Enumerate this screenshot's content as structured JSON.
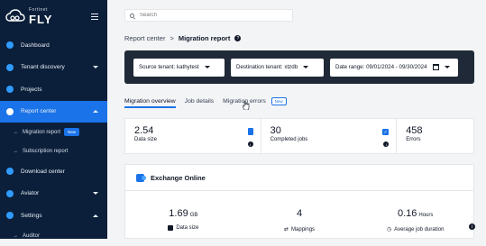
{
  "brand": {
    "top": "Fortinet",
    "name": "FLY"
  },
  "sidebar": {
    "items": [
      {
        "label": "Dashboard"
      },
      {
        "label": "Tenant discovery"
      },
      {
        "label": "Projects"
      },
      {
        "label": "Report center"
      },
      {
        "label": "Migration report",
        "badge": "New"
      },
      {
        "label": "Subscription report"
      },
      {
        "label": "Download center"
      },
      {
        "label": "Aviator"
      },
      {
        "label": "Settings"
      },
      {
        "label": "Auditor"
      }
    ]
  },
  "search": {
    "placeholder": "Search"
  },
  "breadcrumb": {
    "parent": "Report center",
    "separator": ">",
    "current": "Migration report"
  },
  "filters": {
    "source_label": "Source tenant:",
    "source_value": "kathytest",
    "destination_label": "Destination tenant:",
    "destination_value": "xtzdb",
    "date_label": "Date range:",
    "date_value": "09/01/2024 - 09/30/2024"
  },
  "tabs": [
    {
      "label": "Migration overview"
    },
    {
      "label": "Job details"
    },
    {
      "label": "Migration errors",
      "badge": "New"
    }
  ],
  "stats": [
    {
      "value": "2.54",
      "label": "Data size"
    },
    {
      "value": "30",
      "label": "Completed jobs"
    },
    {
      "value": "458",
      "label": "Errors"
    }
  ],
  "exchange": {
    "title": "Exchange Online",
    "stats": [
      {
        "value": "1.69",
        "unit": "GB",
        "label": "Data size"
      },
      {
        "value": "4",
        "unit": "",
        "label": "Mappings"
      },
      {
        "value": "0.16",
        "unit": "Hours",
        "label": "Average job duration"
      }
    ]
  },
  "colors": {
    "sidebar": "#0b1f3a",
    "accent": "#1a73e8",
    "filterbar": "#1f2937"
  }
}
